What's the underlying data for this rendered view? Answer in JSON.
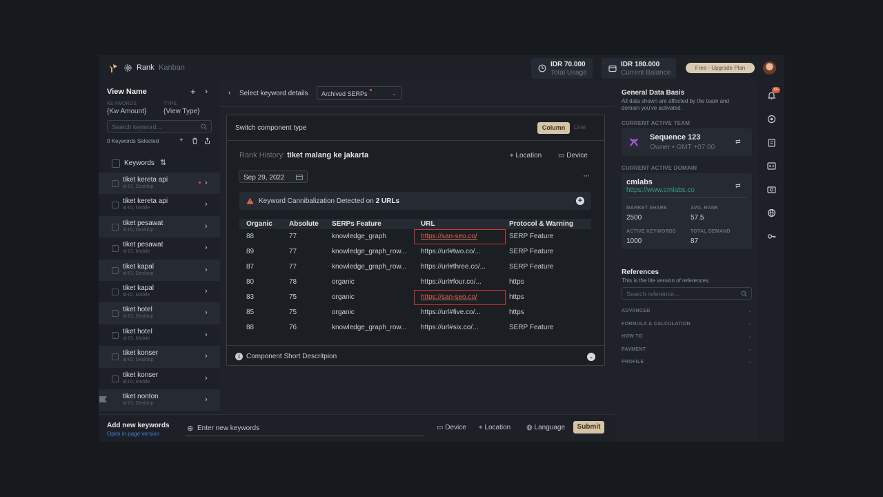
{
  "topbar": {
    "brand": "Rank",
    "brand_sub": "Kanban",
    "usage_value": "IDR 70.000",
    "usage_label": "Total Usage",
    "balance_value": "IDR 180.000",
    "balance_label": "Current Balance",
    "upgrade_label": "Free - Upgrade Plan"
  },
  "left": {
    "view_name": "View Name",
    "keywords_label": "KEYWORDS",
    "keywords_value": "{Kw Amount}",
    "type_label": "TYPE",
    "type_value": "{View Type}",
    "search_placeholder": "Search keyword...",
    "selected_count": "0 Keywords Selected",
    "list_header": "Keywords",
    "items": [
      {
        "name": "tiket kereta api",
        "sub": "id-ID, Desktop"
      },
      {
        "name": "tiket kereta api",
        "sub": "id-ID, Mobile"
      },
      {
        "name": "tiket pesawat",
        "sub": "id-ID, Desktop"
      },
      {
        "name": "tiket pesawat",
        "sub": "id-ID, Mobile"
      },
      {
        "name": "tiket kapal",
        "sub": "id-ID, Desktop"
      },
      {
        "name": "tiket kapal",
        "sub": "id-ID, Mobile"
      },
      {
        "name": "tiket hotel",
        "sub": "id-ID, Desktop"
      },
      {
        "name": "tiket hotel",
        "sub": "id-ID, Mobile"
      },
      {
        "name": "tiket konser",
        "sub": "id-ID, Desktop"
      },
      {
        "name": "tiket konser",
        "sub": "id-ID, Mobile"
      },
      {
        "name": "tiket nonton",
        "sub": "id-ID, Desktop"
      }
    ]
  },
  "center": {
    "crumb_label": "Select keyword details",
    "crumb_dropdown": "Archived SERPs",
    "switch_label": "Switch component type",
    "toggle_column": "Column",
    "toggle_line": "Line",
    "rank_history_label": "Rank History:",
    "rank_history_keyword": "tiket malang ke jakarta",
    "location_label": "Location",
    "device_label": "Device",
    "date": "Sep 29, 2022",
    "warning_text": "Keyword Cannibalization Detected on",
    "warning_strong": "2 URLs",
    "table_headers": [
      "Organic",
      "Absolute",
      "SERPs Feature",
      "URL",
      "Protocol & Warning"
    ],
    "table_rows": [
      [
        "88",
        "77",
        "knowledge_graph",
        "https://san-seo.co/",
        "SERP Feature"
      ],
      [
        "89",
        "77",
        "knowledge_graph_row...",
        "https://url#two.co/...",
        "SERP Feature"
      ],
      [
        "87",
        "77",
        "knowledge_graph_row...",
        "https://url#three.co/...",
        "SERP Feature"
      ],
      [
        "80",
        "78",
        "organic",
        "https://url#four.co/...",
        "https"
      ],
      [
        "83",
        "75",
        "organic",
        "https://san-seo.co/",
        "https"
      ],
      [
        "85",
        "75",
        "organic",
        "https://url#five.co/...",
        "https"
      ],
      [
        "88",
        "76",
        "knowledge_graph_row...",
        "https://url#six.co/...",
        "SERP Feature"
      ]
    ],
    "footer_label": "Component Short Descritpion"
  },
  "bottom": {
    "add_title": "Add new keywords",
    "add_sub": "Open in page version",
    "input_placeholder": "Enter new keywords",
    "device": "Device",
    "location": "Location",
    "language": "Language",
    "submit": "Submit"
  },
  "right": {
    "gdb_title": "General Data Basis",
    "gdb_sub": "All data shown are affected by the team and domain you've activated.",
    "team_section": "CURRENT ACTIVE TEAM",
    "team_name": "Sequence 123",
    "team_sub": "Owner • GMT +07:00",
    "domain_section": "CURRENT ACTIVE DOMAIN",
    "domain_name": "cmlabs",
    "domain_url": "https://www.cmlabs.co",
    "market_share_label": "MARKET SHARE",
    "market_share": "2500",
    "avg_rank_label": "AVG. RANK",
    "avg_rank": "57.5",
    "active_kw_label": "ACTIVE KEYWORDS",
    "active_kw": "1000",
    "total_demand_label": "TOTAL DEMAND",
    "total_demand": "87",
    "ref_title": "References",
    "ref_sub": "This is the lite version of references.",
    "ref_placeholder": "Search reference...",
    "accordions": [
      "ADVANCED",
      "FORMULA & CALCULATION",
      "HOW TO",
      "PAYMENT",
      "PROFILE"
    ]
  },
  "rail": {
    "badge": "10+"
  }
}
